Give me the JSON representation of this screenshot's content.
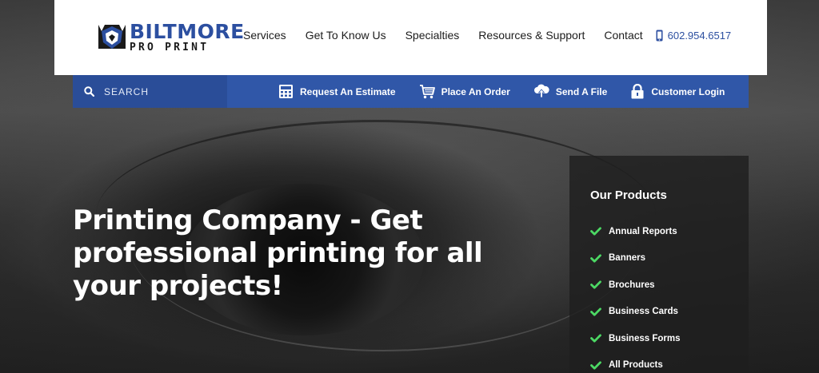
{
  "brand": {
    "name_top": "BILTMORE",
    "name_bottom": "PRO PRINT",
    "primary_color": "#2c4fa0",
    "bar_color": "#3057a8"
  },
  "nav": {
    "items": [
      "Services",
      "Get To Know Us",
      "Specialties",
      "Resources & Support",
      "Contact"
    ],
    "phone": "602.954.6517"
  },
  "utility_bar": {
    "search_placeholder": "SEARCH",
    "links": [
      {
        "label": "Request An Estimate",
        "icon": "calculator-icon"
      },
      {
        "label": "Place An Order",
        "icon": "cart-icon"
      },
      {
        "label": "Send A File",
        "icon": "cloud-upload-icon"
      },
      {
        "label": "Customer Login",
        "icon": "lock-icon"
      }
    ]
  },
  "hero": {
    "headline": "Printing Company - Get professional printing for all your projects!"
  },
  "products": {
    "title": "Our Products",
    "check_color": "#4cd964",
    "items": [
      "Annual Reports",
      "Banners",
      "Brochures",
      "Business Cards",
      "Business Forms",
      "All Products"
    ]
  }
}
